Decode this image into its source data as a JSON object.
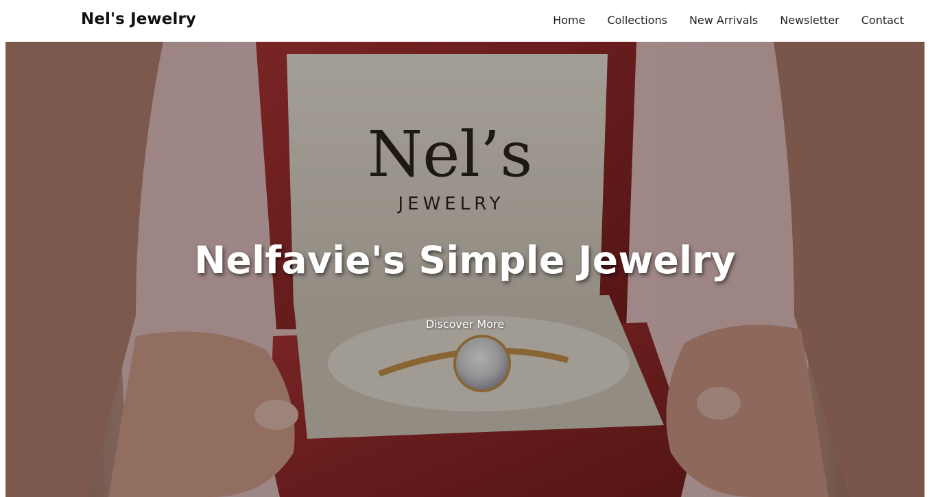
{
  "header": {
    "brand": "Nel's Jewelry",
    "nav": [
      "Home",
      "Collections",
      "New Arrivals",
      "Newsletter",
      "Contact"
    ]
  },
  "hero": {
    "title": "Nelfavie's Simple Jewelry",
    "cta": "Discover More",
    "box_print_name": "Nel’s",
    "box_print_sub": "JEWELRY"
  },
  "colors": {
    "box_red": "#9c2a2a",
    "box_lining": "#e6ddd0",
    "skin": "#d8a48f",
    "shirt": "#e9c8c8",
    "gold": "#c9954c"
  }
}
